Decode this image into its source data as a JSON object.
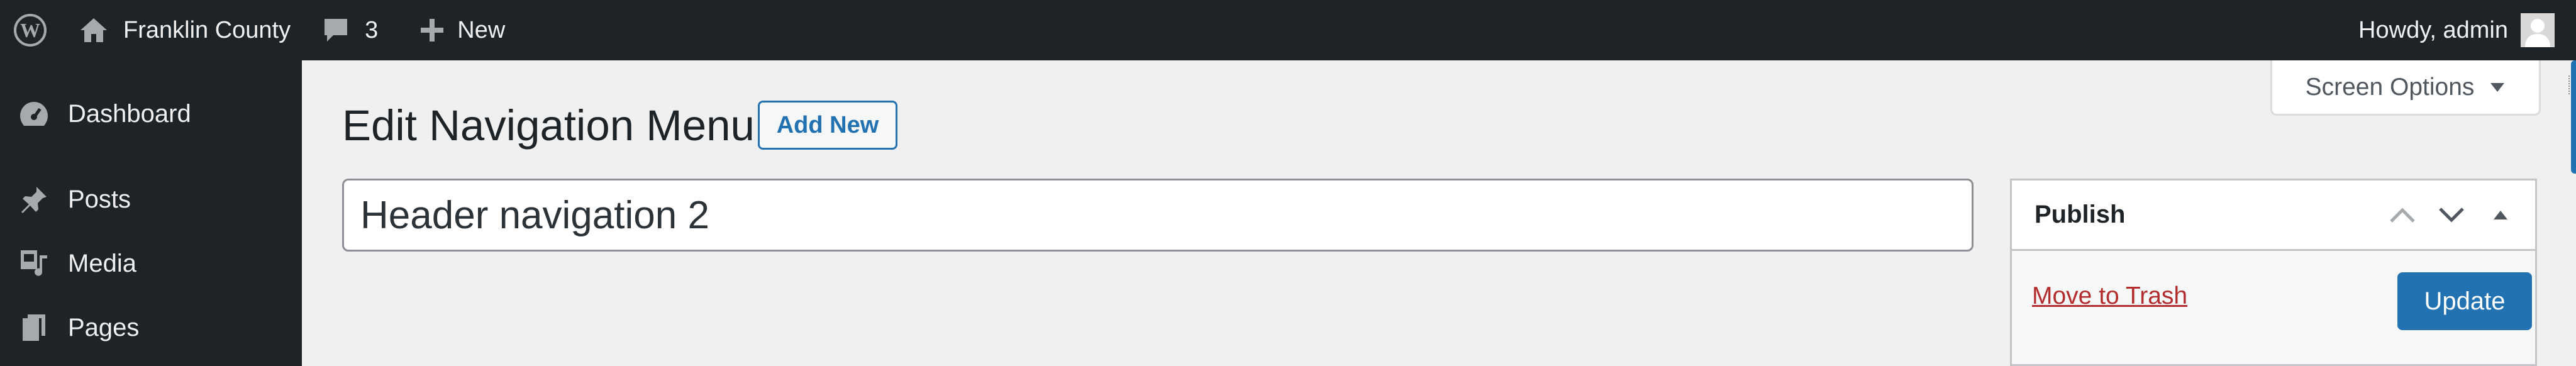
{
  "admin_bar": {
    "site_name": "Franklin County",
    "comments_count": "3",
    "new_label": "New",
    "howdy": "Howdy, admin",
    "icons": {
      "logo": "wordpress-logo-icon",
      "site": "home-icon",
      "comments": "comment-bubble-icon",
      "new": "plus-icon",
      "avatar": "user-avatar-icon"
    }
  },
  "sidebar": {
    "items": [
      {
        "label": "Dashboard",
        "icon": "dashboard-gauge-icon"
      },
      {
        "label": "Posts",
        "icon": "pushpin-icon"
      },
      {
        "label": "Media",
        "icon": "media-icon"
      },
      {
        "label": "Pages",
        "icon": "pages-icon"
      }
    ]
  },
  "main": {
    "title": "Edit Navigation Menu",
    "add_new_label": "Add New",
    "screen_options_label": "Screen Options",
    "menu_name_value": "Header navigation 2"
  },
  "publish": {
    "title": "Publish",
    "move_to_trash": "Move to Trash",
    "update_label": "Update"
  },
  "colors": {
    "admin_bar_bg": "#1d2327",
    "accent": "#2271b1",
    "danger": "#b32d2e",
    "page_bg": "#f0f0f1"
  }
}
